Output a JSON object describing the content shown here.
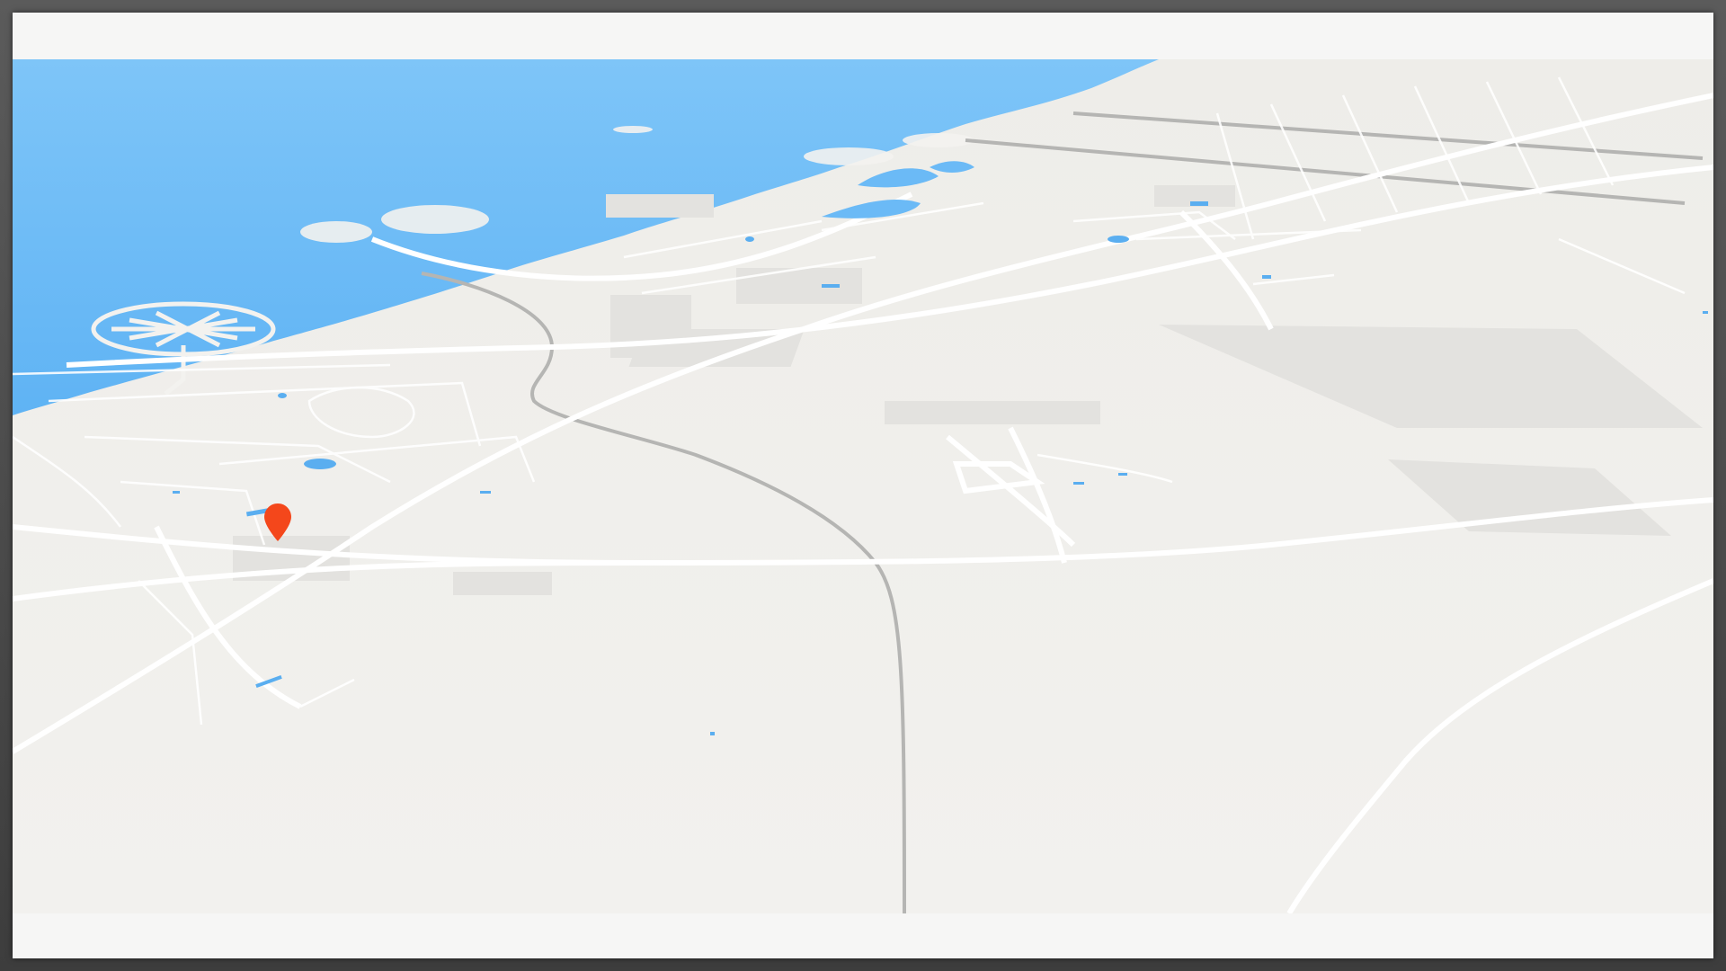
{
  "map": {
    "style": "light-3d-perspective",
    "colors": {
      "water": "#6bbaf6",
      "land": "#efeeeb",
      "road": "#ffffff",
      "highway": "#b6b6b4",
      "district": "#e3e2df",
      "lake": "#5aaef0",
      "pin": "#f4471b",
      "frame": "#4a4a4a"
    },
    "pin": {
      "icon": "location-pin-icon",
      "color": "#f4471b"
    }
  }
}
